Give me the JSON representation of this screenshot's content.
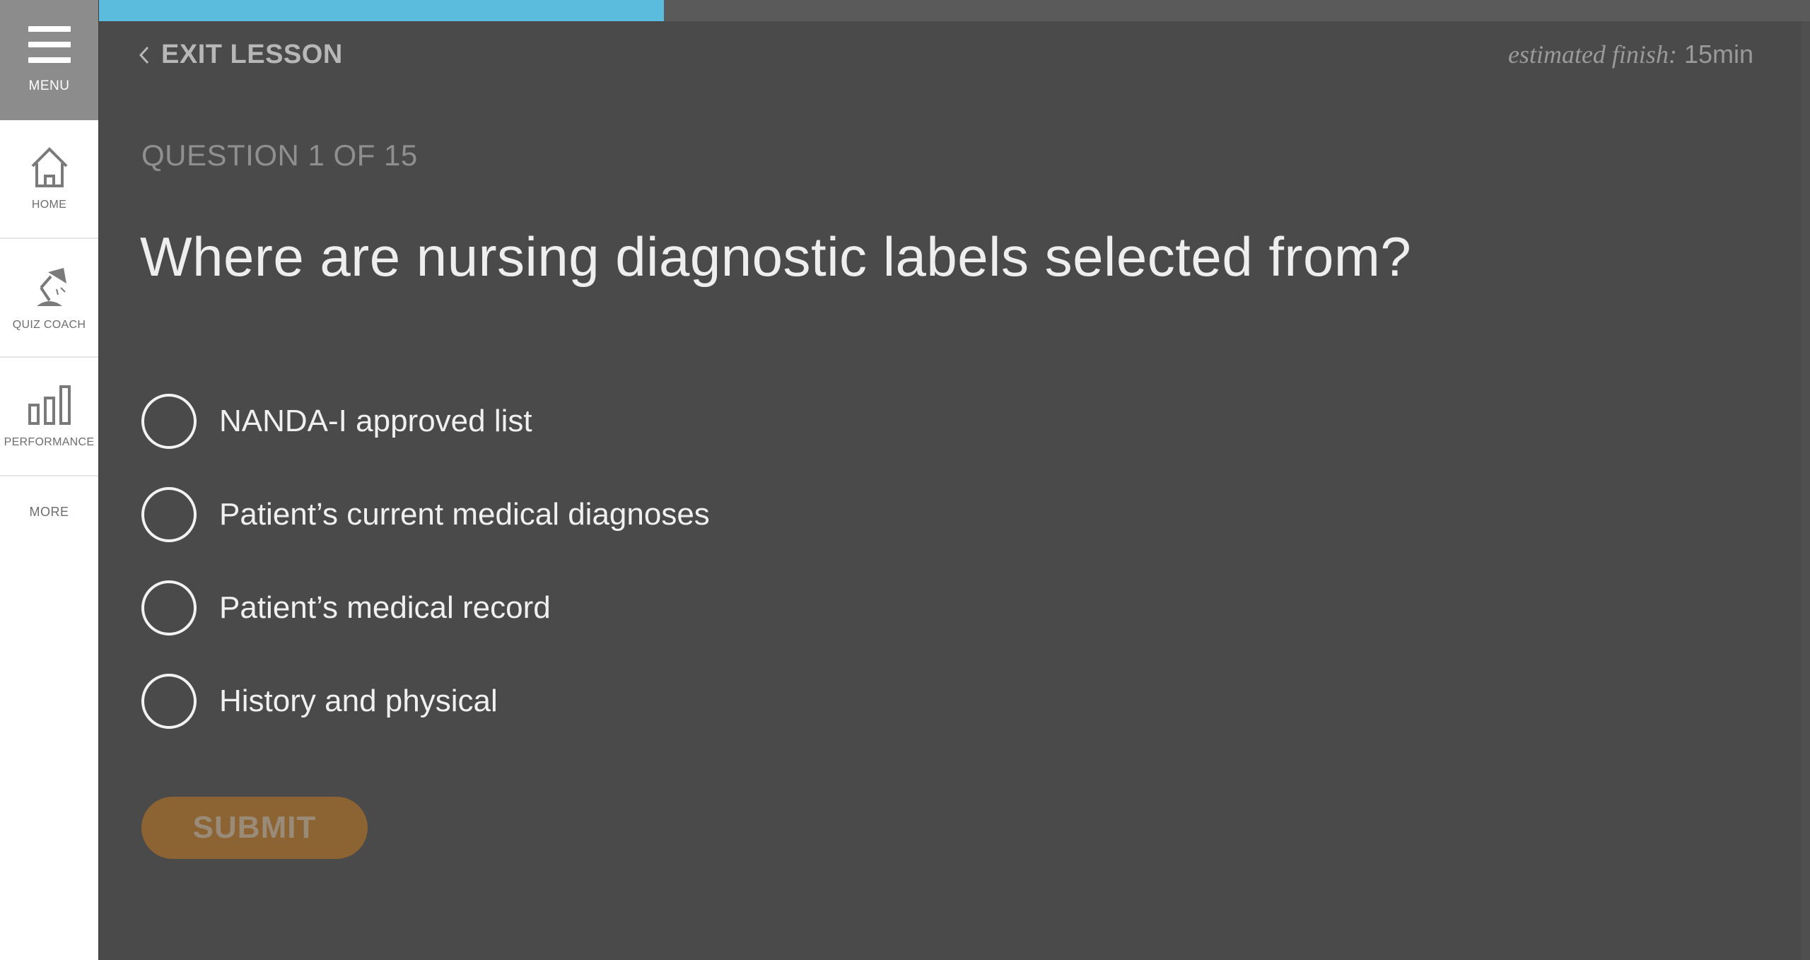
{
  "sidebar": {
    "menu_label": "MENU",
    "items": [
      {
        "label": "HOME",
        "icon": "home-icon"
      },
      {
        "label": "QUIZ COACH",
        "icon": "lamp-icon"
      },
      {
        "label": "PERFORMANCE",
        "icon": "bar-chart-icon"
      }
    ],
    "more_label": "MORE"
  },
  "progress": {
    "fraction": 0.33,
    "color": "#5bbcde"
  },
  "header": {
    "exit_label": "EXIT LESSON",
    "estimate_prefix": "estimated finish:",
    "estimate_value": " 15min"
  },
  "question": {
    "counter": "QUESTION 1 OF 15",
    "text": "Where are nursing diagnostic labels selected from?",
    "options": [
      "NANDA-I approved list",
      "Patient’s current medical diagnoses",
      "Patient’s medical record",
      "History and physical"
    ]
  },
  "submit_label": "SUBMIT",
  "colors": {
    "background": "#4a4a4a",
    "submit": "#8c6433",
    "accent": "#5bbcde"
  }
}
